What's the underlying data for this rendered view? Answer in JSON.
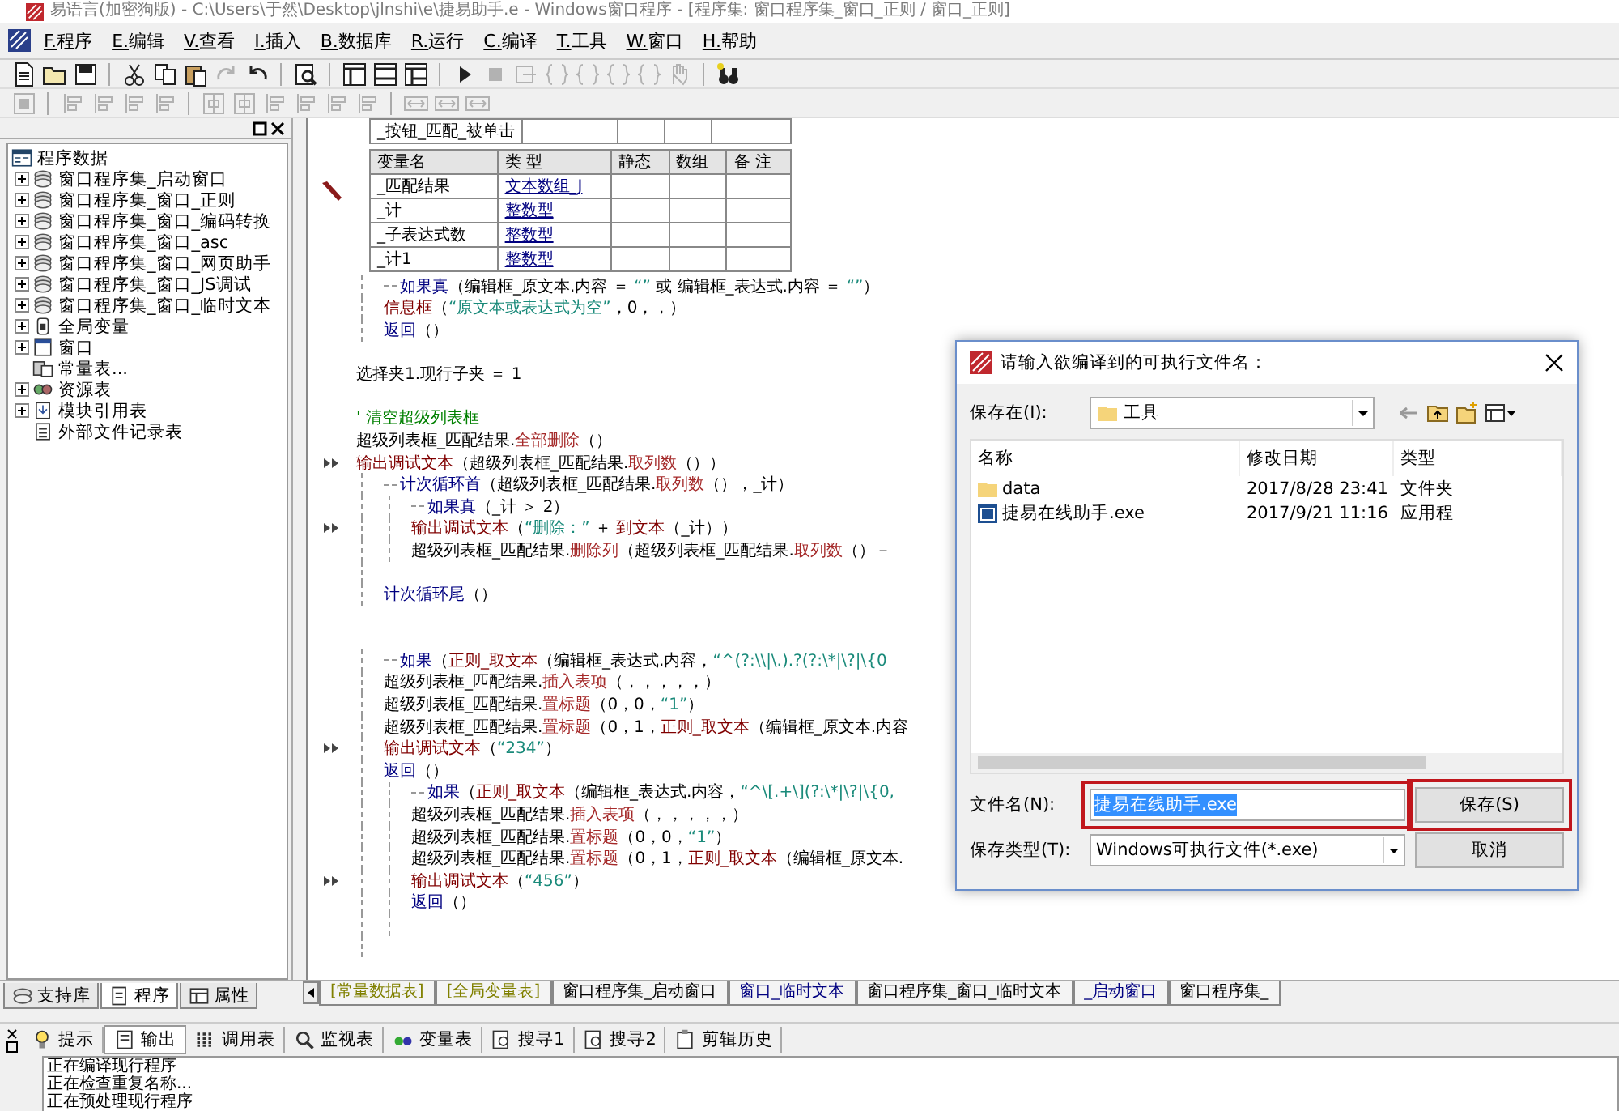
{
  "window": {
    "title": "易语言(加密狗版) - C:\\Users\\于然\\Desktop\\jlnshi\\e\\捷易助手.e - Windows窗口程序 - [程序集: 窗口程序集_窗口_正则 / 窗口_正则]"
  },
  "menu": [
    "F.程序",
    "E.编辑",
    "V.查看",
    "I.插入",
    "B.数据库",
    "R.运行",
    "C.编译",
    "T.工具",
    "W.窗口",
    "H.帮助"
  ],
  "toolbar": [
    {
      "kind": "new",
      "disabled": false
    },
    {
      "kind": "open",
      "disabled": false
    },
    {
      "kind": "save",
      "disabled": false
    },
    {
      "kind": "separator"
    },
    {
      "kind": "cut",
      "disabled": false
    },
    {
      "kind": "copy",
      "disabled": false
    },
    {
      "kind": "paste",
      "disabled": false
    },
    {
      "kind": "redo",
      "disabled": true
    },
    {
      "kind": "undo",
      "disabled": false
    },
    {
      "kind": "separator"
    },
    {
      "kind": "find",
      "disabled": false
    },
    {
      "kind": "separator"
    },
    {
      "kind": "layout-a",
      "disabled": false
    },
    {
      "kind": "layout-b",
      "disabled": false
    },
    {
      "kind": "layout-c",
      "disabled": false
    },
    {
      "kind": "separator"
    },
    {
      "kind": "run",
      "disabled": false
    },
    {
      "kind": "stop",
      "disabled": true
    },
    {
      "kind": "step",
      "disabled": true
    },
    {
      "kind": "brace",
      "disabled": true
    },
    {
      "kind": "brace",
      "disabled": true
    },
    {
      "kind": "brace",
      "disabled": true
    },
    {
      "kind": "brace",
      "disabled": true
    },
    {
      "kind": "hand",
      "disabled": true
    },
    {
      "kind": "separator"
    },
    {
      "kind": "binoculars",
      "disabled": false
    }
  ],
  "toolbar_2": [
    {
      "kind": "grid",
      "disabled": true
    },
    {
      "kind": "separator"
    },
    {
      "kind": "align",
      "disabled": true
    },
    {
      "kind": "align",
      "disabled": true
    },
    {
      "kind": "align",
      "disabled": true
    },
    {
      "kind": "align",
      "disabled": true
    },
    {
      "kind": "separator"
    },
    {
      "kind": "center",
      "disabled": true
    },
    {
      "kind": "center",
      "disabled": true
    },
    {
      "kind": "align",
      "disabled": true
    },
    {
      "kind": "align",
      "disabled": true
    },
    {
      "kind": "align",
      "disabled": true
    },
    {
      "kind": "align",
      "disabled": true
    },
    {
      "kind": "separator"
    },
    {
      "kind": "size",
      "disabled": true
    },
    {
      "kind": "size",
      "disabled": true
    },
    {
      "kind": "size",
      "disabled": true
    }
  ],
  "tree": {
    "label": "程序数据",
    "kind": "root",
    "children": [
      {
        "label": "窗口程序集_启动窗口",
        "kind": "module",
        "expandable": true
      },
      {
        "label": "窗口程序集_窗口_正则",
        "kind": "module",
        "expandable": true
      },
      {
        "label": "窗口程序集_窗口_编码转换",
        "kind": "module",
        "expandable": true
      },
      {
        "label": "窗口程序集_窗口_asc",
        "kind": "module",
        "expandable": true
      },
      {
        "label": "窗口程序集_窗口_网页助手",
        "kind": "module",
        "expandable": true
      },
      {
        "label": "窗口程序集_窗口_JS调试",
        "kind": "module",
        "expandable": true
      },
      {
        "label": "窗口程序集_窗口_临时文本",
        "kind": "module",
        "expandable": true
      },
      {
        "label": "全局变量",
        "kind": "globals",
        "expandable": true
      },
      {
        "label": "窗口",
        "kind": "window",
        "expandable": true
      },
      {
        "label": "常量表...",
        "kind": "constants",
        "expandable": false
      },
      {
        "label": "资源表",
        "kind": "resources",
        "expandable": true
      },
      {
        "label": "模块引用表",
        "kind": "modules",
        "expandable": true
      },
      {
        "label": "外部文件记录表",
        "kind": "files",
        "expandable": false
      }
    ]
  },
  "sub_table": {
    "name": "_按钮_匹配_被单击"
  },
  "var_table": {
    "columns": [
      "变量名",
      "类 型",
      "静态",
      "数组",
      "备 注"
    ],
    "rows": [
      {
        "name": "_匹配结果",
        "type": "文本数组_J"
      },
      {
        "name": "_计",
        "type": "整数型"
      },
      {
        "name": "_子表达式数",
        "type": "整数型"
      },
      {
        "name": "_计1",
        "type": "整数型"
      }
    ]
  },
  "code": [
    {
      "kind": "block",
      "children": [
        {
          "kind": "line",
          "marked": false,
          "segments": [
            {
              "kind": "flow",
              "text": "如果真"
            },
            {
              "kind": "plain",
              "text": "（编辑框_原文本.内容 ＝ "
            },
            {
              "kind": "str",
              "text": "“”"
            },
            {
              "kind": "plain",
              "text": " 或 编辑框_表达式.内容 ＝ "
            },
            {
              "kind": "str",
              "text": "“”"
            },
            {
              "kind": "plain",
              "text": "）"
            }
          ]
        },
        {
          "kind": "line",
          "marked": false,
          "segments": [
            {
              "kind": "cmd",
              "text": "信息框"
            },
            {
              "kind": "plain",
              "text": "（"
            },
            {
              "kind": "str",
              "text": "“原文本或表达式为空”"
            },
            {
              "kind": "plain",
              "text": "，0，，）"
            }
          ]
        },
        {
          "kind": "line",
          "marked": false,
          "segments": [
            {
              "kind": "flow",
              "text": "返回"
            },
            {
              "kind": "plain",
              "text": "（）"
            }
          ]
        }
      ]
    },
    {
      "kind": "blank"
    },
    {
      "kind": "line",
      "marked": false,
      "segments": [
        {
          "kind": "plain",
          "text": "选择夹1.现行子夹 ＝ 1"
        }
      ]
    },
    {
      "kind": "blank"
    },
    {
      "kind": "line",
      "marked": false,
      "segments": [
        {
          "kind": "comment",
          "text": "' 清空超级列表框"
        }
      ]
    },
    {
      "kind": "line",
      "marked": false,
      "segments": [
        {
          "kind": "plain",
          "text": "超级列表框_匹配结果."
        },
        {
          "kind": "method",
          "text": "全部删除"
        },
        {
          "kind": "plain",
          "text": "（）"
        }
      ]
    },
    {
      "kind": "line",
      "marked": true,
      "segments": [
        {
          "kind": "cmd",
          "text": "输出调试文本"
        },
        {
          "kind": "plain",
          "text": "（超级列表框_匹配结果."
        },
        {
          "kind": "method",
          "text": "取列数"
        },
        {
          "kind": "plain",
          "text": "（））"
        }
      ]
    },
    {
      "kind": "block",
      "children": [
        {
          "kind": "line",
          "marked": false,
          "segments": [
            {
              "kind": "flow",
              "text": "计次循环首"
            },
            {
              "kind": "plain",
              "text": "（超级列表框_匹配结果."
            },
            {
              "kind": "method",
              "text": "取列数"
            },
            {
              "kind": "plain",
              "text": "（），_计）"
            }
          ]
        },
        {
          "kind": "block",
          "children": [
            {
              "kind": "line",
              "marked": false,
              "segments": [
                {
                  "kind": "flow",
                  "text": "如果真"
                },
                {
                  "kind": "plain",
                  "text": "（_计 ＞ 2）"
                }
              ]
            },
            {
              "kind": "line",
              "marked": true,
              "segments": [
                {
                  "kind": "cmd",
                  "text": "输出调试文本"
                },
                {
                  "kind": "plain",
                  "text": "（"
                },
                {
                  "kind": "str",
                  "text": "“删除：”"
                },
                {
                  "kind": "plain",
                  "text": " ＋ "
                },
                {
                  "kind": "cmd",
                  "text": "到文本"
                },
                {
                  "kind": "plain",
                  "text": "（_计））"
                }
              ]
            },
            {
              "kind": "line",
              "marked": false,
              "segments": [
                {
                  "kind": "plain",
                  "text": "超级列表框_匹配结果."
                },
                {
                  "kind": "method",
                  "text": "删除列"
                },
                {
                  "kind": "plain",
                  "text": "（超级列表框_匹配结果."
                },
                {
                  "kind": "method",
                  "text": "取列数"
                },
                {
                  "kind": "plain",
                  "text": "（）－"
                }
              ]
            }
          ]
        },
        {
          "kind": "blank"
        },
        {
          "kind": "line",
          "marked": false,
          "segments": [
            {
              "kind": "flow",
              "text": "计次循环尾"
            },
            {
              "kind": "plain",
              "text": "（）"
            }
          ]
        }
      ]
    },
    {
      "kind": "blank"
    },
    {
      "kind": "blank"
    },
    {
      "kind": "block",
      "children": [
        {
          "kind": "line",
          "marked": false,
          "segments": [
            {
              "kind": "flow",
              "text": "如果"
            },
            {
              "kind": "plain",
              "text": "（"
            },
            {
              "kind": "cmd",
              "text": "正则_取文本"
            },
            {
              "kind": "plain",
              "text": "（编辑框_表达式.内容，"
            },
            {
              "kind": "str",
              "text": "“^(?:\\\\|\\.).?(?:\\*|\\?|\\{0"
            }
          ]
        },
        {
          "kind": "line",
          "marked": false,
          "segments": [
            {
              "kind": "plain",
              "text": "超级列表框_匹配结果."
            },
            {
              "kind": "method",
              "text": "插入表项"
            },
            {
              "kind": "plain",
              "text": "（，，，，，）"
            }
          ]
        },
        {
          "kind": "line",
          "marked": false,
          "segments": [
            {
              "kind": "plain",
              "text": "超级列表框_匹配结果."
            },
            {
              "kind": "method",
              "text": "置标题"
            },
            {
              "kind": "plain",
              "text": "（0，0，"
            },
            {
              "kind": "str",
              "text": "“1”"
            },
            {
              "kind": "plain",
              "text": "）"
            }
          ]
        },
        {
          "kind": "line",
          "marked": false,
          "segments": [
            {
              "kind": "plain",
              "text": "超级列表框_匹配结果."
            },
            {
              "kind": "method",
              "text": "置标题"
            },
            {
              "kind": "plain",
              "text": "（0，1，"
            },
            {
              "kind": "cmd",
              "text": "正则_取文本"
            },
            {
              "kind": "plain",
              "text": "（编辑框_原文本.内容"
            }
          ]
        },
        {
          "kind": "line",
          "marked": true,
          "segments": [
            {
              "kind": "cmd",
              "text": "输出调试文本"
            },
            {
              "kind": "plain",
              "text": "（"
            },
            {
              "kind": "str",
              "text": "“234”"
            },
            {
              "kind": "plain",
              "text": "）"
            }
          ]
        },
        {
          "kind": "line",
          "marked": false,
          "segments": [
            {
              "kind": "flow",
              "text": "返回"
            },
            {
              "kind": "plain",
              "text": "（）"
            }
          ]
        },
        {
          "kind": "block",
          "children": [
            {
              "kind": "line",
              "marked": false,
              "segments": [
                {
                  "kind": "flow",
                  "text": "如果"
                },
                {
                  "kind": "plain",
                  "text": "（"
                },
                {
                  "kind": "cmd",
                  "text": "正则_取文本"
                },
                {
                  "kind": "plain",
                  "text": "（编辑框_表达式.内容，"
                },
                {
                  "kind": "str",
                  "text": "“^\\[.+\\](?:\\*|\\?|\\{0,"
                }
              ]
            },
            {
              "kind": "line",
              "marked": false,
              "segments": [
                {
                  "kind": "plain",
                  "text": "超级列表框_匹配结果."
                },
                {
                  "kind": "method",
                  "text": "插入表项"
                },
                {
                  "kind": "plain",
                  "text": "（，，，，，）"
                }
              ]
            },
            {
              "kind": "line",
              "marked": false,
              "segments": [
                {
                  "kind": "plain",
                  "text": "超级列表框_匹配结果."
                },
                {
                  "kind": "method",
                  "text": "置标题"
                },
                {
                  "kind": "plain",
                  "text": "（0，0，"
                },
                {
                  "kind": "str",
                  "text": "“1”"
                },
                {
                  "kind": "plain",
                  "text": "）"
                }
              ]
            },
            {
              "kind": "line",
              "marked": false,
              "segments": [
                {
                  "kind": "plain",
                  "text": "超级列表框_匹配结果."
                },
                {
                  "kind": "method",
                  "text": "置标题"
                },
                {
                  "kind": "plain",
                  "text": "（0，1，"
                },
                {
                  "kind": "cmd",
                  "text": "正则_取文本"
                },
                {
                  "kind": "plain",
                  "text": "（编辑框_原文本."
                }
              ]
            },
            {
              "kind": "line",
              "marked": true,
              "segments": [
                {
                  "kind": "cmd",
                  "text": "输出调试文本"
                },
                {
                  "kind": "plain",
                  "text": "（"
                },
                {
                  "kind": "str",
                  "text": "“456”"
                },
                {
                  "kind": "plain",
                  "text": "）"
                }
              ]
            },
            {
              "kind": "line",
              "marked": false,
              "segments": [
                {
                  "kind": "flow",
                  "text": "返回"
                },
                {
                  "kind": "plain",
                  "text": "（）"
                }
              ]
            },
            {
              "kind": "blank"
            }
          ]
        },
        {
          "kind": "blank"
        }
      ]
    }
  ],
  "panel_tabs": [
    {
      "label": "支持库",
      "kind": "library",
      "selected": false
    },
    {
      "label": "程序",
      "kind": "program",
      "selected": true
    },
    {
      "label": "属性",
      "kind": "properties",
      "selected": false
    }
  ],
  "doc_tabs": [
    {
      "label": "[常量数据表]",
      "color": "#808000"
    },
    {
      "label": "[全局变量表]",
      "color": "#808000"
    },
    {
      "label": "窗口程序集_启动窗口",
      "color": "#000000"
    },
    {
      "label": "窗口_临时文本",
      "color": "#000080"
    },
    {
      "label": "窗口程序集_窗口_临时文本",
      "color": "#000000"
    },
    {
      "label": "_启动窗口",
      "color": "#000080"
    },
    {
      "label": "窗口程序集_",
      "color": "#000000"
    }
  ],
  "output_tabs": [
    {
      "label": "提示",
      "kind": "hint",
      "selected": false
    },
    {
      "label": "输出",
      "kind": "output",
      "selected": true
    },
    {
      "label": "调用表",
      "kind": "calls",
      "selected": false
    },
    {
      "label": "监视表",
      "kind": "watch",
      "selected": false
    },
    {
      "label": "变量表",
      "kind": "vars",
      "selected": false
    },
    {
      "label": "搜寻1",
      "kind": "search",
      "selected": false
    },
    {
      "label": "搜寻2",
      "kind": "search",
      "selected": false
    },
    {
      "label": "剪辑历史",
      "kind": "clip",
      "selected": false
    }
  ],
  "output_lines": [
    "正在编译现行程序",
    "正在检查重复名称...",
    "正在预处理现行程序"
  ],
  "dialog": {
    "title": "请输入欲编译到的可执行文件名：",
    "save_in_label": "保存在(I):",
    "save_in_value": "工具",
    "columns": [
      "名称",
      "修改日期",
      "类型"
    ],
    "files": [
      {
        "name": "data",
        "date": "2017/8/28 23:41",
        "type": "文件夹",
        "kind": "folder"
      },
      {
        "name": "捷易在线助手.exe",
        "date": "2017/9/21 11:16",
        "type": "应用程",
        "kind": "exe"
      }
    ],
    "filename_label": "文件名(N):",
    "filename": {
      "value": "捷易在线助手.exe",
      "selected": true,
      "highlighted": true
    },
    "filetype_label": "保存类型(T):",
    "filetype_value": "Windows可执行文件(*.exe)",
    "buttons": [
      {
        "label": "保存(S)",
        "highlighted": true
      },
      {
        "label": "取消",
        "highlighted": false
      }
    ]
  }
}
